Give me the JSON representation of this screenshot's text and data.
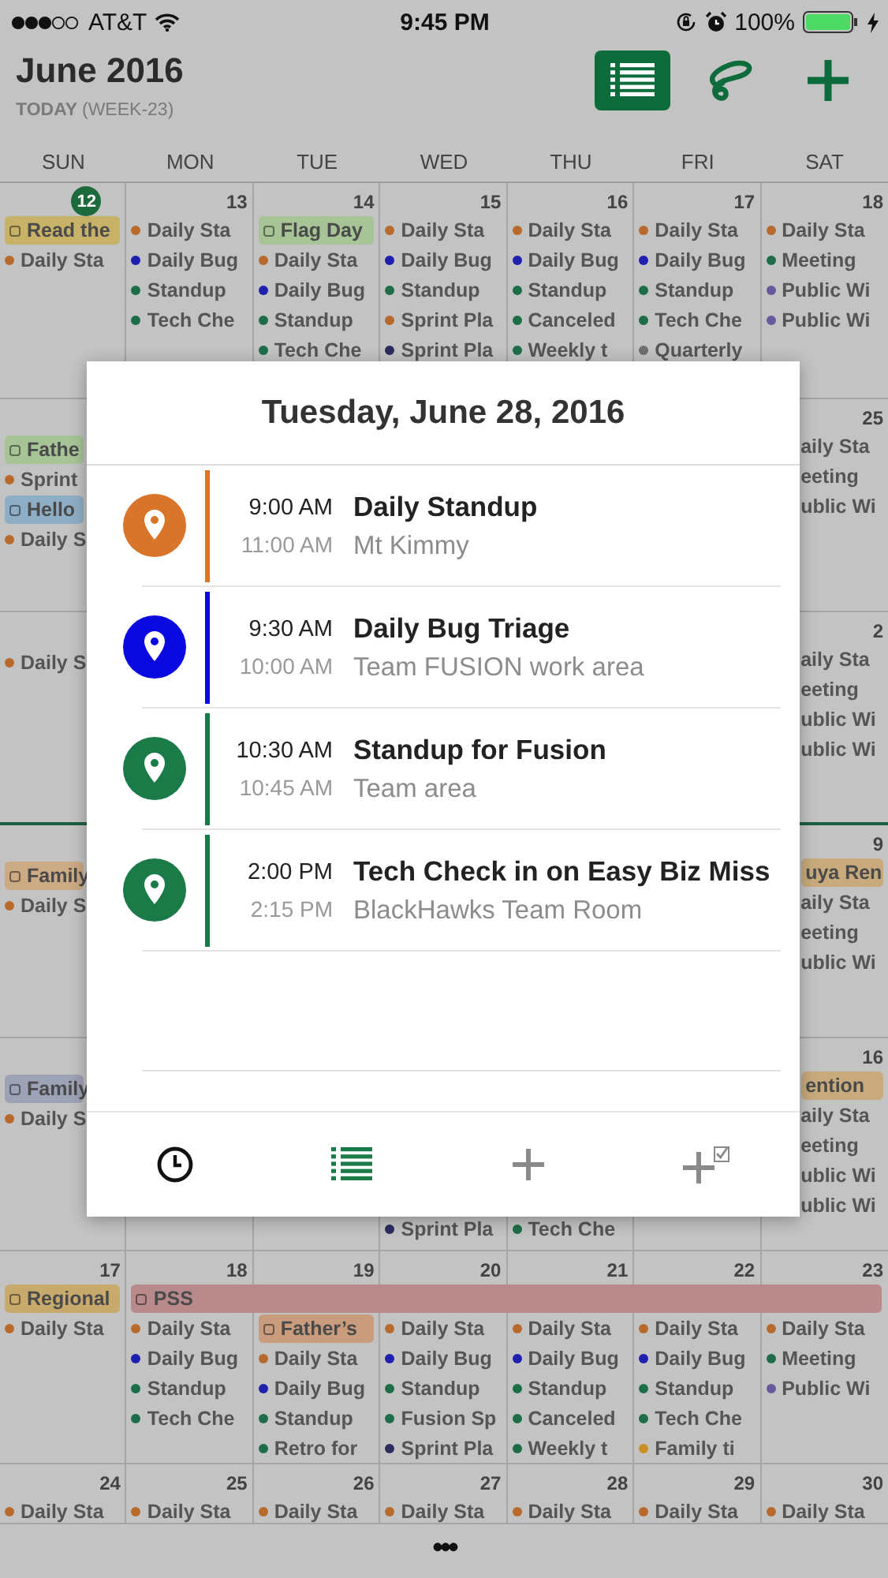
{
  "status_bar": {
    "carrier": "AT&T",
    "time": "9:45 PM",
    "battery": "100%"
  },
  "header": {
    "title": "June 2016",
    "today": "TODAY",
    "week": "(WEEK-23)",
    "actions": [
      {
        "kind": "list",
        "selected": true
      },
      {
        "kind": "lasso",
        "selected": false
      },
      {
        "kind": "add",
        "selected": false
      }
    ]
  },
  "weekdays": [
    "SUN",
    "MON",
    "TUE",
    "WED",
    "THU",
    "FRI",
    "SAT"
  ],
  "weeks": [
    {
      "bottom_highlight": false,
      "cells": [
        {
          "kind": "day",
          "date": "12",
          "today": true,
          "items": [
            {
              "kind": "banner",
              "label": "Read the",
              "color": "#c8b268"
            },
            {
              "kind": "event",
              "label": "Daily Sta",
              "color": "#b8692e"
            }
          ]
        },
        {
          "kind": "day",
          "date": "13",
          "today": false,
          "items": [
            {
              "kind": "event",
              "label": "Daily Sta",
              "color": "#b8692e"
            },
            {
              "kind": "event",
              "label": "Daily Bug",
              "color": "#2020b0"
            },
            {
              "kind": "event",
              "label": "Standup",
              "color": "#1d6e48"
            },
            {
              "kind": "event",
              "label": "Tech Che",
              "color": "#1d6e48"
            }
          ]
        },
        {
          "kind": "day",
          "date": "14",
          "today": false,
          "items": [
            {
              "kind": "banner",
              "label": "Flag Day",
              "color": "#a6c496"
            },
            {
              "kind": "event",
              "label": "Daily Sta",
              "color": "#b8692e"
            },
            {
              "kind": "event",
              "label": "Daily Bug",
              "color": "#2020b0"
            },
            {
              "kind": "event",
              "label": "Standup",
              "color": "#1d6e48"
            },
            {
              "kind": "event",
              "label": "Tech Che",
              "color": "#1d6e48"
            }
          ]
        },
        {
          "kind": "day",
          "date": "15",
          "today": false,
          "items": [
            {
              "kind": "event",
              "label": "Daily Sta",
              "color": "#b8692e"
            },
            {
              "kind": "event",
              "label": "Daily Bug",
              "color": "#2020b0"
            },
            {
              "kind": "event",
              "label": "Standup",
              "color": "#1d6e48"
            },
            {
              "kind": "event",
              "label": "Sprint Pla",
              "color": "#b8692e"
            },
            {
              "kind": "event",
              "label": "Sprint Pla",
              "color": "#2c2c60"
            }
          ]
        },
        {
          "kind": "day",
          "date": "16",
          "today": false,
          "items": [
            {
              "kind": "event",
              "label": "Daily Sta",
              "color": "#b8692e"
            },
            {
              "kind": "event",
              "label": "Daily Bug",
              "color": "#2020b0"
            },
            {
              "kind": "event",
              "label": "Standup",
              "color": "#1d6e48"
            },
            {
              "kind": "event",
              "label": "Canceled",
              "color": "#1d6e48"
            },
            {
              "kind": "event",
              "label": "Weekly t",
              "color": "#1d6e48"
            }
          ]
        },
        {
          "kind": "day",
          "date": "17",
          "today": false,
          "items": [
            {
              "kind": "event",
              "label": "Daily Sta",
              "color": "#b8692e"
            },
            {
              "kind": "event",
              "label": "Daily Bug",
              "color": "#2020b0"
            },
            {
              "kind": "event",
              "label": "Standup",
              "color": "#1d6e48"
            },
            {
              "kind": "event",
              "label": "Tech Che",
              "color": "#1d6e48"
            },
            {
              "kind": "event",
              "label": "Quarterly",
              "color": "#707070"
            }
          ]
        },
        {
          "kind": "day",
          "date": "18",
          "today": false,
          "items": [
            {
              "kind": "event",
              "label": "Daily Sta",
              "color": "#b8692e"
            },
            {
              "kind": "event",
              "label": "Meeting",
              "color": "#1d6e48"
            },
            {
              "kind": "event",
              "label": "Public Wi",
              "color": "#6858a0"
            },
            {
              "kind": "event",
              "label": "Public Wi",
              "color": "#6858a0"
            }
          ]
        }
      ]
    },
    {
      "bottom_highlight": false,
      "cells": [
        {
          "kind": "cut-right",
          "items": [
            {
              "kind": "banner",
              "label": "Fathe",
              "color": "#a6c496"
            },
            {
              "kind": "event",
              "label": "Sprint",
              "color": "#b8692e"
            },
            {
              "kind": "banner",
              "label": "Hello",
              "color": "#8eaec6"
            },
            {
              "kind": "event",
              "label": "Daily S",
              "color": "#b8692e"
            }
          ]
        },
        {
          "kind": "hidden"
        },
        {
          "kind": "hidden"
        },
        {
          "kind": "hidden"
        },
        {
          "kind": "hidden"
        },
        {
          "kind": "hidden"
        },
        {
          "kind": "cut-left",
          "date": "25",
          "today": false,
          "items": [
            {
              "kind": "event",
              "label": "aily Sta"
            },
            {
              "kind": "event",
              "label": "eeting"
            },
            {
              "kind": "event",
              "label": "ublic Wi"
            }
          ]
        }
      ]
    },
    {
      "bottom_highlight": true,
      "cells": [
        {
          "kind": "cut-right",
          "items": [
            {
              "kind": "event",
              "label": "Daily S",
              "color": "#b8692e"
            }
          ]
        },
        {
          "kind": "hidden"
        },
        {
          "kind": "hidden"
        },
        {
          "kind": "hidden"
        },
        {
          "kind": "hidden"
        },
        {
          "kind": "hidden"
        },
        {
          "kind": "cut-left",
          "date": "2",
          "today": false,
          "items": [
            {
              "kind": "event",
              "label": "aily Sta"
            },
            {
              "kind": "event",
              "label": "eeting"
            },
            {
              "kind": "event",
              "label": "ublic Wi"
            },
            {
              "kind": "event",
              "label": "ublic Wi"
            }
          ]
        }
      ]
    },
    {
      "bottom_highlight": false,
      "cells": [
        {
          "kind": "cut-right",
          "items": [
            {
              "kind": "banner",
              "label": "Family",
              "color": "#ccaa84"
            },
            {
              "kind": "event",
              "label": "Daily S",
              "color": "#b8692e"
            }
          ]
        },
        {
          "kind": "hidden"
        },
        {
          "kind": "hidden"
        },
        {
          "kind": "hidden"
        },
        {
          "kind": "hidden"
        },
        {
          "kind": "hidden"
        },
        {
          "kind": "cut-left",
          "date": "9",
          "today": false,
          "items": [
            {
              "kind": "banner",
              "label": "uya Ren",
              "color": "#c8aa7c"
            },
            {
              "kind": "event",
              "label": "aily Sta"
            },
            {
              "kind": "event",
              "label": "eeting"
            },
            {
              "kind": "event",
              "label": "ublic Wi"
            }
          ]
        }
      ]
    },
    {
      "bottom_highlight": false,
      "cells": [
        {
          "kind": "cut-right",
          "items": [
            {
              "kind": "banner",
              "label": "Family",
              "color": "#9ea2b6"
            },
            {
              "kind": "event",
              "label": "Daily S",
              "color": "#b8692e"
            }
          ]
        },
        {
          "kind": "hidden"
        },
        {
          "kind": "hidden"
        },
        {
          "kind": "cut-top",
          "items": [
            {
              "kind": "event",
              "label": "Sprint Pla",
              "color": "#2c2c60"
            }
          ]
        },
        {
          "kind": "cut-top",
          "items": [
            {
              "kind": "event",
              "label": "Tech Che",
              "color": "#1d6e48"
            }
          ]
        },
        {
          "kind": "hidden"
        },
        {
          "kind": "cut-left",
          "date": "16",
          "today": false,
          "items": [
            {
              "kind": "banner",
              "label": "ention",
              "color": "#c8aa7c"
            },
            {
              "kind": "event",
              "label": "aily Sta"
            },
            {
              "kind": "event",
              "label": "eeting"
            },
            {
              "kind": "event",
              "label": "ublic Wi"
            },
            {
              "kind": "event",
              "label": "ublic Wi"
            }
          ]
        }
      ]
    },
    {
      "bottom_highlight": false,
      "cells": [
        {
          "kind": "day",
          "date": "17",
          "today": false,
          "items": [
            {
              "kind": "banner",
              "label": "Regional",
              "color": "#c8aa6c"
            },
            {
              "kind": "event",
              "label": "Daily Sta",
              "color": "#b8692e"
            }
          ]
        },
        {
          "kind": "day",
          "date": "18",
          "today": false,
          "items": [
            {
              "kind": "banner",
              "label": "PSS",
              "color": "#b88a8c",
              "to_week_end": true
            },
            {
              "kind": "event",
              "label": "Daily Sta",
              "color": "#b8692e"
            },
            {
              "kind": "event",
              "label": "Daily Bug",
              "color": "#2020b0"
            },
            {
              "kind": "event",
              "label": "Standup",
              "color": "#1d6e48"
            },
            {
              "kind": "event",
              "label": "Tech Che",
              "color": "#1d6e48"
            }
          ]
        },
        {
          "kind": "day",
          "date": "19",
          "today": false,
          "items": [
            {
              "kind": "continued"
            },
            {
              "kind": "banner",
              "label": "Father’s",
              "color": "#c89c7c"
            },
            {
              "kind": "event",
              "label": "Daily Sta",
              "color": "#b8692e"
            },
            {
              "kind": "event",
              "label": "Daily Bug",
              "color": "#2020b0"
            },
            {
              "kind": "event",
              "label": "Standup",
              "color": "#1d6e48"
            },
            {
              "kind": "event",
              "label": "Retro for",
              "color": "#1d6e48"
            }
          ]
        },
        {
          "kind": "day",
          "date": "20",
          "today": false,
          "items": [
            {
              "kind": "continued"
            },
            {
              "kind": "event",
              "label": "Daily Sta",
              "color": "#b8692e"
            },
            {
              "kind": "event",
              "label": "Daily Bug",
              "color": "#2020b0"
            },
            {
              "kind": "event",
              "label": "Standup",
              "color": "#1d6e48"
            },
            {
              "kind": "event",
              "label": "Fusion Sp",
              "color": "#1d6e48"
            },
            {
              "kind": "event",
              "label": "Sprint Pla",
              "color": "#2c2c60"
            }
          ]
        },
        {
          "kind": "day",
          "date": "21",
          "today": false,
          "items": [
            {
              "kind": "continued"
            },
            {
              "kind": "event",
              "label": "Daily Sta",
              "color": "#b8692e"
            },
            {
              "kind": "event",
              "label": "Daily Bug",
              "color": "#2020b0"
            },
            {
              "kind": "event",
              "label": "Standup",
              "color": "#1d6e48"
            },
            {
              "kind": "event",
              "label": "Canceled",
              "color": "#1d6e48"
            },
            {
              "kind": "event",
              "label": "Weekly t",
              "color": "#1d6e48"
            }
          ]
        },
        {
          "kind": "day",
          "date": "22",
          "today": false,
          "items": [
            {
              "kind": "continued"
            },
            {
              "kind": "event",
              "label": "Daily Sta",
              "color": "#b8692e"
            },
            {
              "kind": "event",
              "label": "Daily Bug",
              "color": "#2020b0"
            },
            {
              "kind": "event",
              "label": "Standup",
              "color": "#1d6e48"
            },
            {
              "kind": "event",
              "label": "Tech Che",
              "color": "#1d6e48"
            },
            {
              "kind": "event",
              "label": "Family ti",
              "color": "#c89020"
            }
          ]
        },
        {
          "kind": "day",
          "date": "23",
          "today": false,
          "items": [
            {
              "kind": "continued"
            },
            {
              "kind": "event",
              "label": "Daily Sta",
              "color": "#b8692e"
            },
            {
              "kind": "event",
              "label": "Meeting",
              "color": "#1d6e48"
            },
            {
              "kind": "event",
              "label": "Public Wi",
              "color": "#6858a0"
            }
          ]
        }
      ]
    },
    {
      "bottom_highlight": false,
      "cells": [
        {
          "kind": "day",
          "date": "24",
          "today": false,
          "items": [
            {
              "kind": "event",
              "label": "Daily Sta",
              "color": "#b8692e"
            }
          ]
        },
        {
          "kind": "day",
          "date": "25",
          "today": false,
          "items": [
            {
              "kind": "event",
              "label": "Daily Sta",
              "color": "#b8692e"
            }
          ]
        },
        {
          "kind": "day",
          "date": "26",
          "today": false,
          "items": [
            {
              "kind": "event",
              "label": "Daily Sta",
              "color": "#b8692e"
            }
          ]
        },
        {
          "kind": "day",
          "date": "27",
          "today": false,
          "items": [
            {
              "kind": "event",
              "label": "Daily Sta",
              "color": "#b8692e"
            }
          ]
        },
        {
          "kind": "day",
          "date": "28",
          "today": false,
          "items": [
            {
              "kind": "event",
              "label": "Daily Sta",
              "color": "#b8692e"
            }
          ]
        },
        {
          "kind": "day",
          "date": "29",
          "today": false,
          "items": [
            {
              "kind": "event",
              "label": "Daily Sta",
              "color": "#b8692e"
            }
          ]
        },
        {
          "kind": "day",
          "date": "30",
          "today": false,
          "items": [
            {
              "kind": "event",
              "label": "Daily Sta",
              "color": "#b8692e"
            }
          ]
        }
      ]
    }
  ],
  "popup": {
    "title": "Tuesday, June 28, 2016",
    "events": [
      {
        "start": "9:00 AM",
        "end": "11:00 AM",
        "title": "Daily Standup",
        "location": "Mt Kimmy",
        "color": "#d8752a"
      },
      {
        "start": "9:30 AM",
        "end": "10:00 AM",
        "title": "Daily Bug Triage",
        "location": "Team FUSION work area",
        "color": "#0a0ae0"
      },
      {
        "start": "10:30 AM",
        "end": "10:45 AM",
        "title": "Standup for Fusion",
        "location": "Team area",
        "color": "#1a7a48"
      },
      {
        "start": "2:00 PM",
        "end": "2:15 PM",
        "title": "Tech Check in on Easy Biz Miss",
        "location": "BlackHawks Team Room",
        "color": "#1a7a48"
      }
    ],
    "tools": [
      {
        "kind": "clock",
        "selected": false
      },
      {
        "kind": "list",
        "selected": true
      },
      {
        "kind": "add",
        "selected": false
      },
      {
        "kind": "add-task",
        "selected": false
      }
    ]
  },
  "more": "•••"
}
